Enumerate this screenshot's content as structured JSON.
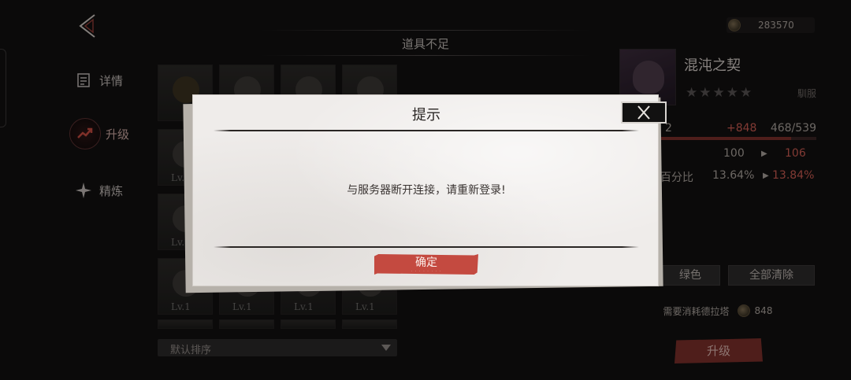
{
  "nav": {
    "back_icon": "back-arrow-icon",
    "items": [
      {
        "label": "详情",
        "icon": "details-icon",
        "active": false
      },
      {
        "label": "升级",
        "icon": "upgrade-icon",
        "active": true
      },
      {
        "label": "精炼",
        "icon": "refine-icon",
        "active": false
      }
    ]
  },
  "banner": {
    "text": "道具不足"
  },
  "currency": {
    "icon": "coin-icon",
    "amount": "283570"
  },
  "grid": {
    "level_label": "Lv.1",
    "sort_label": "默认排序"
  },
  "character": {
    "name": "混沌之契",
    "stars": "★★★★★",
    "tag": "馴服",
    "xp_gain": "+848",
    "xp_total": "468/539",
    "xp_fill_percent": 87,
    "level_prefix": "2",
    "stat1_current": "100",
    "stat1_next": "106",
    "stat2_label": "百分比",
    "stat2_current": "13.64%",
    "stat2_next": "13.84%"
  },
  "buttons": {
    "green_label": "绿色",
    "clear_all_label": "全部清除",
    "cost_label": "需要消耗德拉塔",
    "cost_amount": "848",
    "upgrade_label": "升级"
  },
  "dialog": {
    "title": "提示",
    "message": "与服务器断开连接，请重新登录!",
    "confirm_label": "确定",
    "close_icon": "close-icon"
  },
  "colors": {
    "accent_red": "#c44a40",
    "stat_red": "#c85a50",
    "dialog_bg": "#efecea",
    "background": "#111010"
  }
}
